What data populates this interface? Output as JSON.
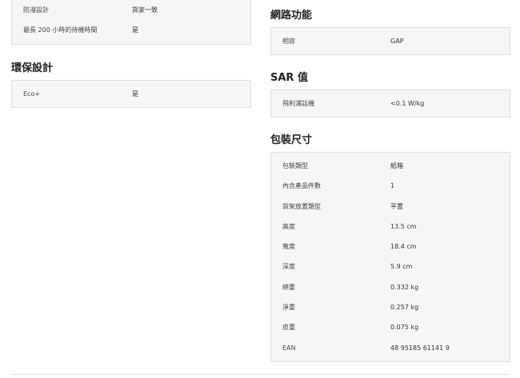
{
  "left": {
    "top_rows": [
      {
        "label": "防潑設計",
        "value": "貨家一致"
      },
      {
        "label": "最長 200 小時的待機時間",
        "value": "是"
      }
    ],
    "eco_title": "環保設計",
    "eco_rows": [
      {
        "label": "Eco+",
        "value": "是"
      }
    ]
  },
  "right": {
    "network_title": "網路功能",
    "network_rows": [
      {
        "label": "相容",
        "value": "GAP"
      }
    ],
    "sar_title": "SAR 值",
    "sar_rows": [
      {
        "label": "飛利浦話機",
        "value": "<0.1 W/kg"
      }
    ],
    "pack_title": "包裝尺寸",
    "pack_rows": [
      {
        "label": "包裝類型",
        "value": "紙箱"
      },
      {
        "label": "內含產品件數",
        "value": "1"
      },
      {
        "label": "貨架放置類型",
        "value": "平置"
      },
      {
        "label": "高度",
        "value": "13.5  cm"
      },
      {
        "label": "寬度",
        "value": "18.4  cm"
      },
      {
        "label": "深度",
        "value": "5.9  cm"
      },
      {
        "label": "總重",
        "value": "0.332  kg"
      },
      {
        "label": "淨重",
        "value": "0.257  kg"
      },
      {
        "label": "皮重",
        "value": "0.075  kg"
      },
      {
        "label": "EAN",
        "value": "48 95185 61141 9"
      }
    ]
  }
}
